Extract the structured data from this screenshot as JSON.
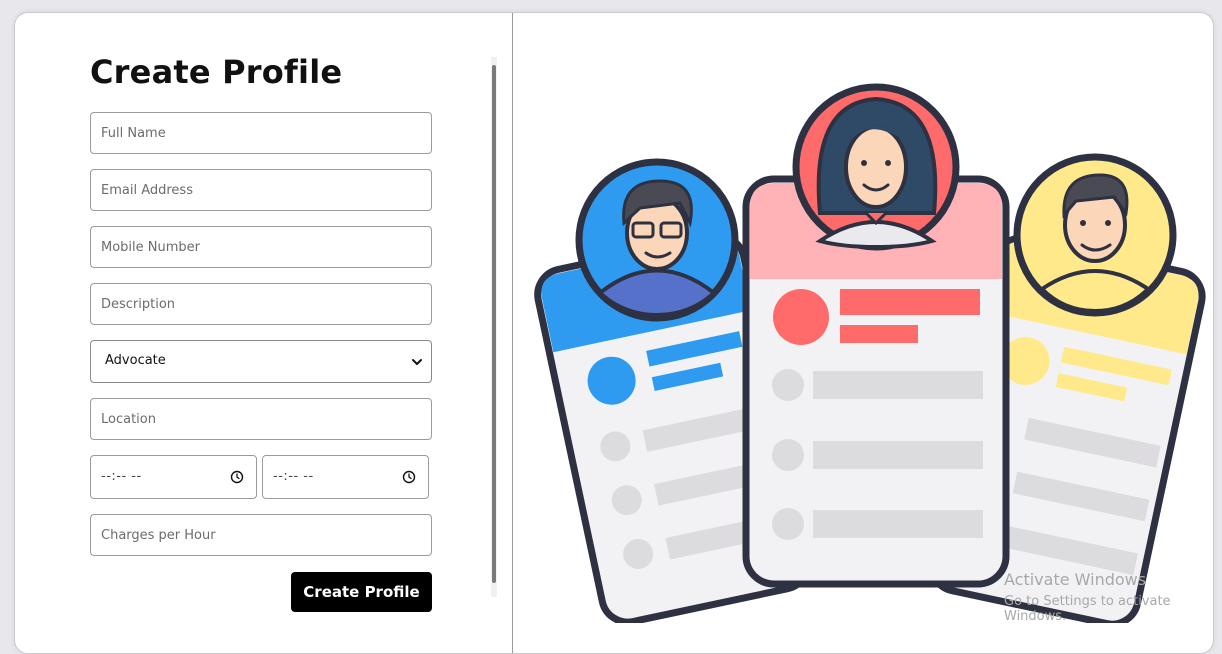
{
  "form": {
    "title": "Create Profile",
    "full_name_placeholder": "Full Name",
    "email_placeholder": "Email Address",
    "mobile_placeholder": "Mobile Number",
    "description_placeholder": "Description",
    "category_selected": "Advocate",
    "location_placeholder": "Location",
    "start_time_placeholder": "--:-- --",
    "end_time_placeholder": "--:-- --",
    "charges_placeholder": "Charges per Hour",
    "submit_label": "Create Profile"
  },
  "watermark": {
    "line1": "Activate Windows",
    "line2": "Go to Settings to activate Windows."
  },
  "colors": {
    "blue_card": "#2e9bf0",
    "pink_card": "#ffb3b6",
    "yellow_card": "#ffe98a",
    "accent_red": "#ff6b6b",
    "outline": "#2d3142"
  },
  "icons": [
    "chevron-down-icon",
    "clock-icon"
  ]
}
